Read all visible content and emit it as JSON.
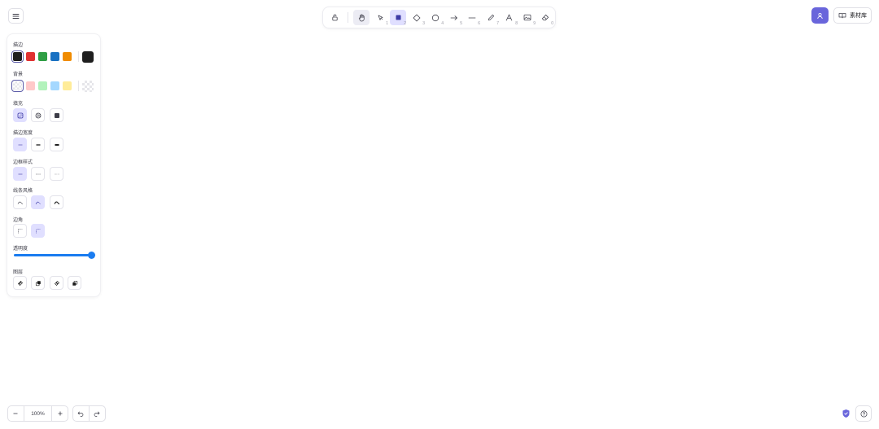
{
  "top_left": {
    "menu_icon": "hamburger-icon"
  },
  "toolbar": {
    "tools": [
      {
        "name": "lock",
        "icon": "lock-icon",
        "key": ""
      },
      {
        "name": "hand",
        "icon": "hand-icon",
        "key": ""
      },
      {
        "name": "selection",
        "icon": "pointer-icon",
        "key": "1"
      },
      {
        "name": "rectangle",
        "icon": "rectangle-icon",
        "key": "2",
        "active": true
      },
      {
        "name": "diamond",
        "icon": "diamond-icon",
        "key": "3"
      },
      {
        "name": "ellipse",
        "icon": "ellipse-icon",
        "key": "4"
      },
      {
        "name": "arrow",
        "icon": "arrow-icon",
        "key": "5"
      },
      {
        "name": "line",
        "icon": "line-icon",
        "key": "6"
      },
      {
        "name": "draw",
        "icon": "pencil-icon",
        "key": "7"
      },
      {
        "name": "text",
        "icon": "text-icon",
        "key": "8"
      },
      {
        "name": "image",
        "icon": "image-icon",
        "key": "9"
      },
      {
        "name": "eraser",
        "icon": "eraser-icon",
        "key": "0"
      }
    ]
  },
  "top_right": {
    "library_label": "素材库",
    "collab_icon": "users-icon",
    "library_icon": "book-icon"
  },
  "panel": {
    "stroke_label": "描边",
    "stroke_colors": [
      "#1e1e1e",
      "#e03131",
      "#2f9e44",
      "#1971c2",
      "#f08c00"
    ],
    "stroke_current": "#1e1e1e",
    "background_label": "背景",
    "background_colors": [
      "transparent",
      "#ffc9c9",
      "#b2f2bb",
      "#a5d8ff",
      "#ffec99"
    ],
    "background_current": "transparent",
    "fill_label": "填充",
    "stroke_width_label": "描边宽度",
    "stroke_style_label": "边框样式",
    "sloppiness_label": "线条风格",
    "edges_label": "边角",
    "opacity_label": "透明度",
    "opacity_value": 100,
    "layers_label": "图层"
  },
  "footer": {
    "zoom": "100%",
    "undo_icon": "undo-icon",
    "redo_icon": "redo-icon",
    "help_icon": "help-icon",
    "shield_icon": "shield-icon"
  },
  "colors": {
    "accent": "#6965db",
    "accent_light": "#e0dfff",
    "slider": "#1a7cf0"
  }
}
